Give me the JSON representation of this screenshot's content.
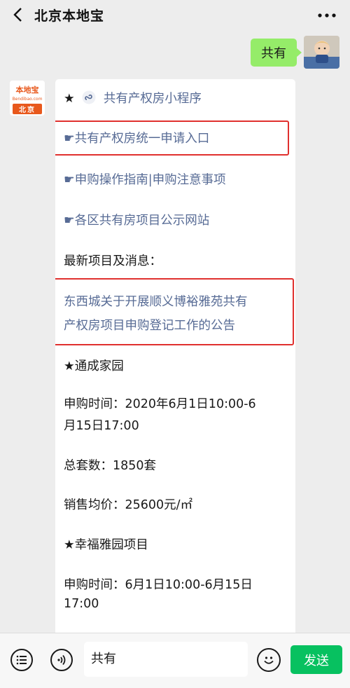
{
  "header": {
    "title": "北京本地宝",
    "back_icon": "chevron-left-icon",
    "more_icon": "more-dots-icon"
  },
  "my_message": {
    "text": "共有"
  },
  "bot": {
    "avatar_logo_text": "本地宝",
    "avatar_logo_sub": "Bendibao.com",
    "avatar_city": "北京",
    "menu": {
      "miniprogram_star": "★",
      "miniprogram_label": "共有产权房小程序",
      "item1": "☛共有产权房统一申请入口",
      "item2": "☛申购操作指南|申购注意事项",
      "item3": "☛各区共有房项目公示网站"
    },
    "news_heading": "最新项目及消息：",
    "news_link_line1": "东西城关于开展顺义博裕雅苑共有",
    "news_link_line2": "产权房项目申购登记工作的公告",
    "project1": {
      "name": "★通成家园",
      "time_line1": "申购时间：2020年6月1日10:00-6",
      "time_line2": "月15日17:00",
      "total": "总套数：1850套",
      "price": "销售均价：25600元/㎡"
    },
    "project2": {
      "name": "★幸福雅园项目",
      "time_line1": "申购时间：6月1日10:00-6月15日",
      "time_line2": "17:00"
    }
  },
  "bottom_bar": {
    "menu_icon": "list-menu-icon",
    "voice_icon": "voice-icon",
    "input_value": "共有",
    "emoji_icon": "emoji-icon",
    "send_label": "发送"
  },
  "colors": {
    "background": "#ededed",
    "my_bubble": "#95ec69",
    "link": "#576b95",
    "highlight_box": "#e0302e",
    "send_button": "#07c160",
    "logo_orange": "#e8581c"
  }
}
